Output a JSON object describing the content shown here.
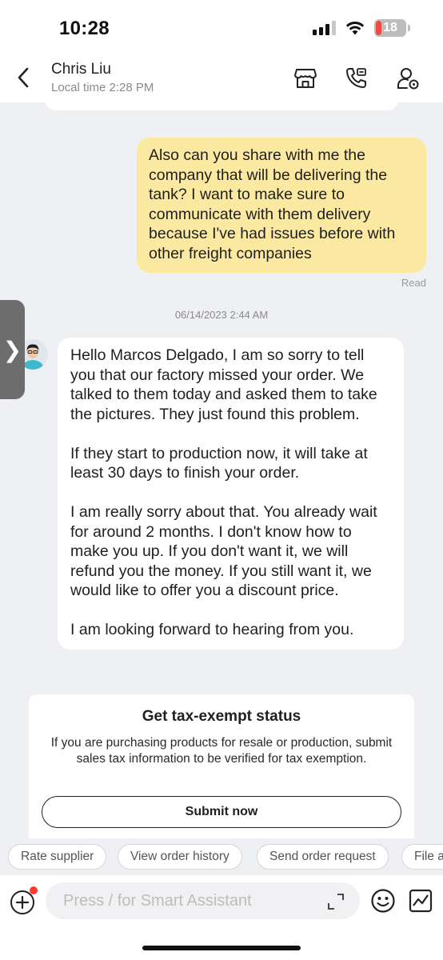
{
  "status": {
    "time": "10:28",
    "battery": "18"
  },
  "header": {
    "name": "Chris Liu",
    "subtitle": "Local time 2:28 PM"
  },
  "messages": {
    "outgoing_text": "Also can you share with me the company that will be delivering the tank? I want to make sure to communicate with them delivery because I've had issues before with other freight companies",
    "read_label": "Read",
    "timestamp": "06/14/2023 2:44 AM",
    "incoming_paragraphs": [
      "Hello Marcos Delgado, I am so sorry to tell you that our factory missed your order. We talked to them today and asked them to take the pictures. They just found this problem.",
      "If they start to production now, it will take at least 30 days to finish your order.",
      "I am really sorry about that. You already wait for around 2 months. I don't know how to make you up. If you don't want it, we will refund you the money. If you still want it, we would like to offer you a discount price.",
      "I am looking forward to hearing from you."
    ]
  },
  "side_tab": {
    "glyph": "❯"
  },
  "tax_card": {
    "title": "Get tax-exempt status",
    "description": "If you are purchasing products for resale or production, submit sales tax information to be verified for tax exemption.",
    "button": "Submit now"
  },
  "quick_actions": [
    "Rate supplier",
    "View order history",
    "Send order request",
    "File a"
  ],
  "composer": {
    "placeholder": "Press / for Smart Assistant"
  },
  "colors": {
    "outgoing_bubble": "#fbe9a1",
    "background": "#eff0f4",
    "notification_dot": "#ff3b30",
    "battery_low": "#f04a3e"
  },
  "icons": [
    "back-icon",
    "store-icon",
    "phone-icon",
    "contact-icon",
    "add-icon",
    "expand-icon",
    "emoji-icon",
    "sticker-icon"
  ]
}
